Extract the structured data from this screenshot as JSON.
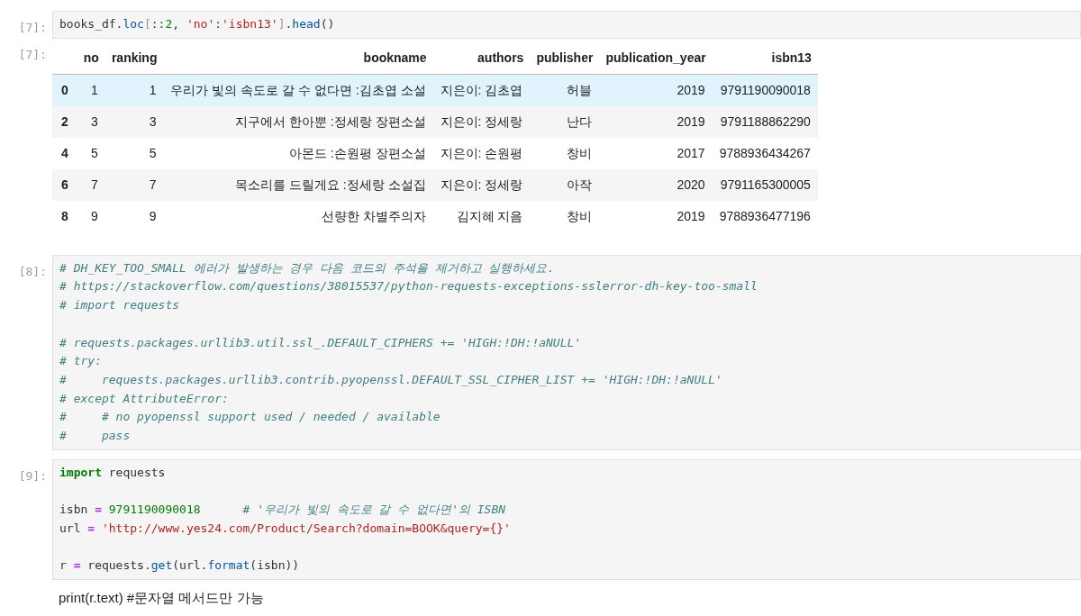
{
  "cells": [
    {
      "kind": "code",
      "prompt": "[7]:",
      "lines": [
        {
          "kind": "code",
          "tokens": [
            {
              "kind": "plain",
              "text": "books_df."
            },
            {
              "kind": "func",
              "text": "loc"
            },
            {
              "kind": "bracket",
              "text": "["
            },
            {
              "kind": "plain",
              "text": "::"
            },
            {
              "kind": "number",
              "text": "2"
            },
            {
              "kind": "plain",
              "text": ", "
            },
            {
              "kind": "string",
              "text": "'no'"
            },
            {
              "kind": "plain",
              "text": ":"
            },
            {
              "kind": "string",
              "text": "'isbn13'"
            },
            {
              "kind": "bracket",
              "text": "]"
            },
            {
              "kind": "plain",
              "text": "."
            },
            {
              "kind": "func",
              "text": "head"
            },
            {
              "kind": "plain",
              "text": "()"
            }
          ]
        }
      ]
    },
    {
      "kind": "table",
      "prompt": "[7]:",
      "columns": [
        "no",
        "ranking",
        "bookname",
        "authors",
        "publisher",
        "publication_year",
        "isbn13"
      ],
      "rows": [
        {
          "index": "0",
          "highlighted": true,
          "cells": [
            "1",
            "1",
            "우리가 빛의 속도로 갈 수 없다면 :김초엽 소설",
            "지은이: 김초엽",
            "허블",
            "2019",
            "9791190090018"
          ]
        },
        {
          "index": "2",
          "highlighted": false,
          "cells": [
            "3",
            "3",
            "지구에서 한아뿐 :정세랑 장편소설",
            "지은이: 정세랑",
            "난다",
            "2019",
            "9791188862290"
          ]
        },
        {
          "index": "4",
          "highlighted": false,
          "cells": [
            "5",
            "5",
            "아몬드 :손원평 장편소설",
            "지은이: 손원평",
            "창비",
            "2017",
            "9788936434267"
          ]
        },
        {
          "index": "6",
          "highlighted": false,
          "cells": [
            "7",
            "7",
            "목소리를 드릴게요 :정세랑 소설집",
            "지은이: 정세랑",
            "아작",
            "2020",
            "9791165300005"
          ]
        },
        {
          "index": "8",
          "highlighted": false,
          "cells": [
            "9",
            "9",
            "선량한 차별주의자",
            "김지혜 지음",
            "창비",
            "2019",
            "9788936477196"
          ]
        }
      ]
    },
    {
      "kind": "code",
      "prompt": "[8]:",
      "lines": [
        {
          "kind": "code",
          "tokens": [
            {
              "kind": "comment",
              "text": "# DH_KEY_TOO_SMALL 에러가 발생하는 경우 다음 코드의 주석을 제거하고 실행하세요."
            }
          ]
        },
        {
          "kind": "code",
          "tokens": [
            {
              "kind": "comment",
              "text": "# https://stackoverflow.com/questions/38015537/python-requests-exceptions-sslerror-dh-key-too-small"
            }
          ]
        },
        {
          "kind": "code",
          "tokens": [
            {
              "kind": "comment",
              "text": "# import requests"
            }
          ]
        },
        {
          "kind": "blank"
        },
        {
          "kind": "code",
          "tokens": [
            {
              "kind": "comment",
              "text": "# requests.packages.urllib3.util.ssl_.DEFAULT_CIPHERS += 'HIGH:!DH:!aNULL'"
            }
          ]
        },
        {
          "kind": "code",
          "tokens": [
            {
              "kind": "comment",
              "text": "# try:"
            }
          ]
        },
        {
          "kind": "code",
          "tokens": [
            {
              "kind": "comment",
              "text": "#     requests.packages.urllib3.contrib.pyopenssl.DEFAULT_SSL_CIPHER_LIST += 'HIGH:!DH:!aNULL'"
            }
          ]
        },
        {
          "kind": "code",
          "tokens": [
            {
              "kind": "comment",
              "text": "# except AttributeError:"
            }
          ]
        },
        {
          "kind": "code",
          "tokens": [
            {
              "kind": "comment",
              "text": "#     # no pyopenssl support used / needed / available"
            }
          ]
        },
        {
          "kind": "code",
          "tokens": [
            {
              "kind": "comment",
              "text": "#     pass"
            }
          ]
        }
      ]
    },
    {
      "kind": "code",
      "prompt": "[9]:",
      "lines": [
        {
          "kind": "code",
          "tokens": [
            {
              "kind": "keyword",
              "text": "import"
            },
            {
              "kind": "plain",
              "text": " requests"
            }
          ]
        },
        {
          "kind": "blank"
        },
        {
          "kind": "code",
          "tokens": [
            {
              "kind": "plain",
              "text": "isbn "
            },
            {
              "kind": "op",
              "text": "="
            },
            {
              "kind": "number",
              "text": " 9791190090018      "
            },
            {
              "kind": "comment",
              "text": "# '우리가 빛의 속도로 갈 수 없다면'의 ISBN"
            }
          ]
        },
        {
          "kind": "code",
          "tokens": [
            {
              "kind": "plain",
              "text": "url "
            },
            {
              "kind": "op",
              "text": "="
            },
            {
              "kind": "string",
              "text": " 'http://www.yes24.com/Product/Search?domain=BOOK&query={}'"
            }
          ]
        },
        {
          "kind": "blank"
        },
        {
          "kind": "code",
          "tokens": [
            {
              "kind": "plain",
              "text": "r "
            },
            {
              "kind": "op",
              "text": "="
            },
            {
              "kind": "plain",
              "text": " requests."
            },
            {
              "kind": "func",
              "text": "get"
            },
            {
              "kind": "plain",
              "text": "(url."
            },
            {
              "kind": "func",
              "text": "format"
            },
            {
              "kind": "plain",
              "text": "(isbn))"
            }
          ]
        }
      ]
    },
    {
      "kind": "text",
      "text": "print(r.text) #문자열 메서드만 가능"
    }
  ]
}
